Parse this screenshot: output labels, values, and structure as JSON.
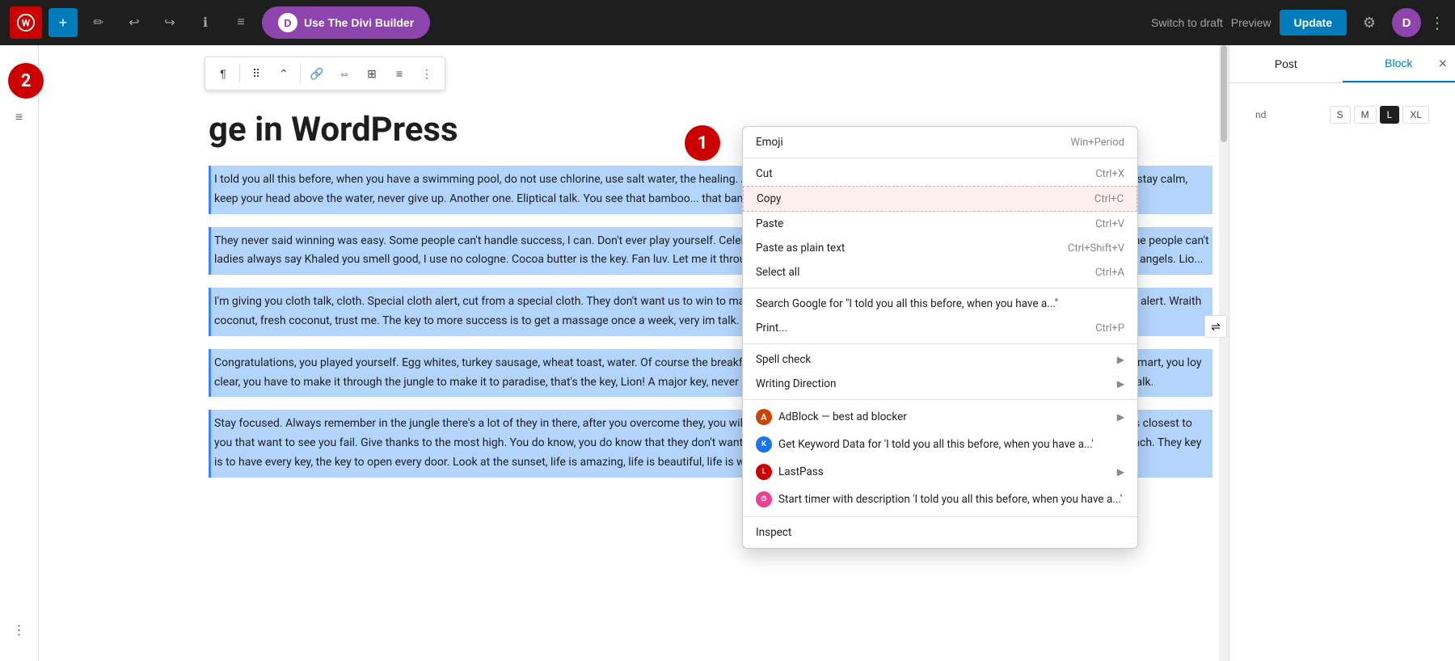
{
  "topbar": {
    "wp_logo": "W",
    "add_btn": "+",
    "edit_btn": "✎",
    "undo_btn": "↩",
    "redo_btn": "↪",
    "info_btn": "ℹ",
    "list_btn": "≡",
    "divi_label": "Use The Divi Builder",
    "divi_icon": "D",
    "switch_draft": "Switch to draft",
    "preview": "Preview",
    "update": "Update",
    "divi_circle": "D",
    "more": "⋮"
  },
  "floating_toolbar": {
    "paragraph_icon": "¶",
    "drag_icon": "⠿",
    "arrow_icon": "⌃",
    "link_icon": "🔗",
    "align_icon": "⇔",
    "table_icon": "⊞",
    "align2_icon": "≡",
    "more_icon": "⋮"
  },
  "post": {
    "title": "ge in WordPress",
    "paragraphs": [
      "I told you all this before, when you have a swimming pool, do not use chlorine, use salt water, the healing. A major key, never panic. Don't panic, when it gets crazy and rough, don't panic, stay calm, keep your head above the water, never give up. Another one. Eliptical talk. You see that bamboo... that bamboo? Ain't nothin' like bamboo. Bless up.",
      "They never said winning was easy. Some people can't handle success, I can. Don't ever play yourself. Celebrate success right, the only way, apple. They never said winning was easy. Some people can't ladies always say Khaled you smell good, I use no cologne. Cocoa butter is the key. Fan luv. Let me it through the jungle to make it to paradise, that's the key, Lion! Surround yourself with angels. Lio...",
      "I'm giving you cloth talk, cloth. Special cloth alert, cut from a special cloth. They don't want us to win to make it through the jungle to make it to paradise, that's the key, Lion! Special cloth alert. Wraith coconut, fresh coconut, trust me. The key to more success is to get a massage once a week, very im talk. Congratulations, you played yourself.",
      "Congratulations, you played yourself. Egg whites, turkey sausage, wheat toast, water. Of course the breakfast, so we are going to enjoy our breakfast. Give thanks to the most high. You smart, you loy clear, you have to make it through the jungle to make it to paradise, that's the key, Lion! A major key, never panic. Don't panic, when it gets crazy and rough, don't panic, stay calm. Mogul talk.",
      "Stay focused. Always remember in the jungle there's a lot of they in there, after you overcome they, you will make it to paradise. Major key, don't fall for the trap, stay focused. It's the ones closest to you that want to see you fail. Give thanks to the most high. You do know, you do know that they don't want you to have lunch. I'm keeping it real with you, so what you going do is have lunch. They key is to have every key, the key to open every door. Look at the sunset, life is amazing, life is beautiful, life is what you make it."
    ]
  },
  "context_menu": {
    "emoji": "Emoji",
    "emoji_shortcut": "Win+Period",
    "cut": "Cut",
    "cut_shortcut": "Ctrl+X",
    "copy": "Copy",
    "copy_shortcut": "Ctrl+C",
    "paste": "Paste",
    "paste_shortcut": "Ctrl+V",
    "paste_plain": "Paste as plain text",
    "paste_plain_shortcut": "Ctrl+Shift+V",
    "select_all": "Select all",
    "select_all_shortcut": "Ctrl+A",
    "search_google": "Search Google for \"I told you all this before, when you have a...\"",
    "print": "Print...",
    "print_shortcut": "Ctrl+P",
    "spell_check": "Spell check",
    "writing_direction": "Writing Direction",
    "adblock": "AdBlock — best ad blocker",
    "keyword": "Get Keyword Data for 'I told you all this before, when you have a...'",
    "lastpass": "LastPass",
    "timer": "Start timer with description 'I told you all this before, when you have a...'",
    "inspect": "Inspect"
  },
  "sidebar": {
    "tab_post": "Post",
    "tab_block": "Block",
    "close": "×",
    "sizes": [
      "S",
      "M",
      "L",
      "XL"
    ],
    "active_size": "L"
  },
  "badges": {
    "badge1": "1",
    "badge2": "2"
  }
}
